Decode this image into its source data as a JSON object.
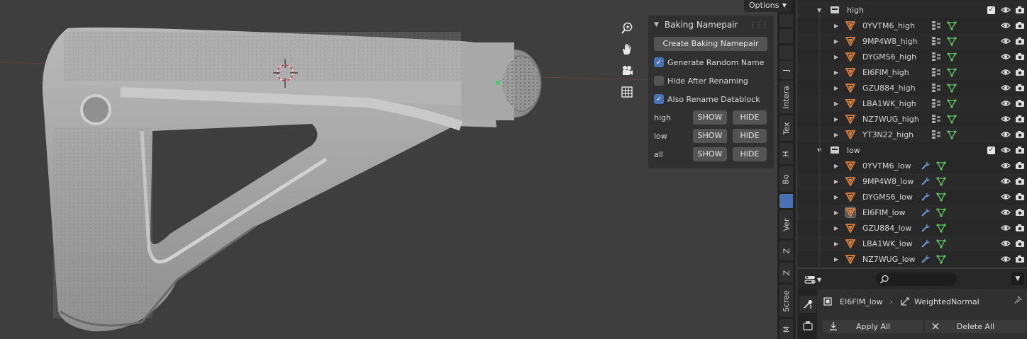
{
  "viewport": {
    "options_label": "Options"
  },
  "npanel": {
    "title": "Baking Namepair",
    "create_button": "Create Baking Namepair",
    "checkboxes": [
      {
        "label": "Generate Random Name",
        "checked": true
      },
      {
        "label": "Hide After Renaming",
        "checked": false
      },
      {
        "label": "Also Rename Datablock",
        "checked": true
      }
    ],
    "rows": [
      {
        "label": "high",
        "show": "SHOW",
        "hide": "HIDE"
      },
      {
        "label": "low",
        "show": "SHOW",
        "hide": "HIDE"
      },
      {
        "label": "all",
        "show": "SHOW",
        "hide": "HIDE"
      }
    ]
  },
  "sidebar_tabs": [
    "J",
    "Intera",
    "Tex",
    "H",
    "Bo",
    "Ver",
    "Z",
    "Z",
    "Scree",
    "M"
  ],
  "outliner": {
    "collections": [
      {
        "name": "high",
        "objects": [
          "0YVTM6_high",
          "9MP4W8_high",
          "DYGMS6_high",
          "EI6FIM_high",
          "GZU884_high",
          "LBA1WK_high",
          "NZ7WUG_high",
          "YT3N22_high"
        ]
      },
      {
        "name": "low",
        "objects": [
          "0YVTM6_low",
          "9MP4W8_low",
          "DYGMS6_low",
          "EI6FIM_low",
          "GZU884_low",
          "LBA1WK_low",
          "NZ7WUG_low"
        ]
      }
    ],
    "selected_object": "EI6FIM_low"
  },
  "properties": {
    "object_name": "EI6FIM_low",
    "modifier_name": "WeightedNormal",
    "apply_all": "Apply All",
    "delete_all": "Delete All"
  },
  "colors": {
    "accent": "#4772b3",
    "mesh_orange": "#e0823c",
    "data_green": "#5fc45f",
    "modifier_blue": "#6f9ad8"
  }
}
